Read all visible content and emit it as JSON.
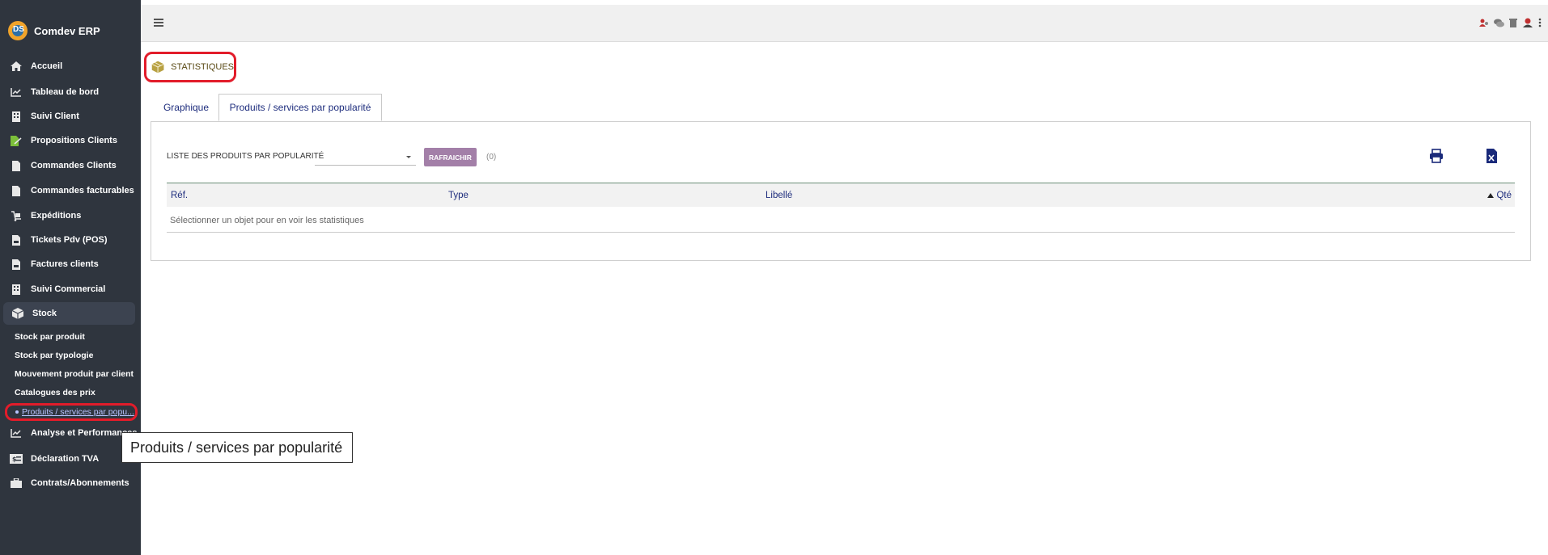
{
  "app": {
    "brand_name": "Comdev ERP",
    "brand_logo_letters": "DS"
  },
  "sidebar": {
    "items": [
      {
        "label": "Accueil",
        "icon": "home-icon"
      },
      {
        "label": "Tableau de bord",
        "icon": "chart-line-icon"
      },
      {
        "label": "Suivi Client",
        "icon": "building-icon"
      },
      {
        "label": "Propositions Clients",
        "icon": "file-signature-icon"
      },
      {
        "label": "Commandes Clients",
        "icon": "file-icon"
      },
      {
        "label": "Commandes facturables",
        "icon": "file-icon"
      },
      {
        "label": "Expéditions",
        "icon": "dolly-icon"
      },
      {
        "label": "Tickets Pdv (POS)",
        "icon": "file-invoice-icon"
      },
      {
        "label": "Factures clients",
        "icon": "file-invoice-icon"
      },
      {
        "label": "Suivi Commercial",
        "icon": "building-icon"
      },
      {
        "label": "Stock",
        "icon": "cube-icon"
      },
      {
        "label": "Analyse et Performances",
        "icon": "chart-line-icon"
      },
      {
        "label": "Déclaration TVA",
        "icon": "tax-icon"
      },
      {
        "label": "Contrats/Abonnements",
        "icon": "briefcase-icon"
      }
    ],
    "stock_subitems": [
      {
        "label": "Stock par produit"
      },
      {
        "label": "Stock par typologie"
      },
      {
        "label": "Mouvement produit par client"
      },
      {
        "label": "Catalogues des prix"
      },
      {
        "label": "Produits / services par popu..."
      }
    ]
  },
  "tooltip": {
    "text": "Produits / services par popularité"
  },
  "page": {
    "title": "STATISTIQUES"
  },
  "tabs": [
    {
      "label": "Graphique",
      "active": false
    },
    {
      "label": "Produits / services par popularité",
      "active": true
    }
  ],
  "filter": {
    "label": "LISTE DES PRODUITS PAR POPULARITÉ",
    "select_value": "",
    "refresh_label": "RAFRAICHIR",
    "count": "(0)"
  },
  "table": {
    "columns": [
      "Réf.",
      "Type",
      "Libellé",
      "Qté"
    ],
    "empty_message": "Sélectionner un objet pour en voir les statistiques"
  },
  "colors": {
    "sidebar_bg": "#2f353e",
    "accent_purple": "#a37fa8",
    "link_blue": "#1e2d7d",
    "highlight_red": "#e21c2a"
  }
}
